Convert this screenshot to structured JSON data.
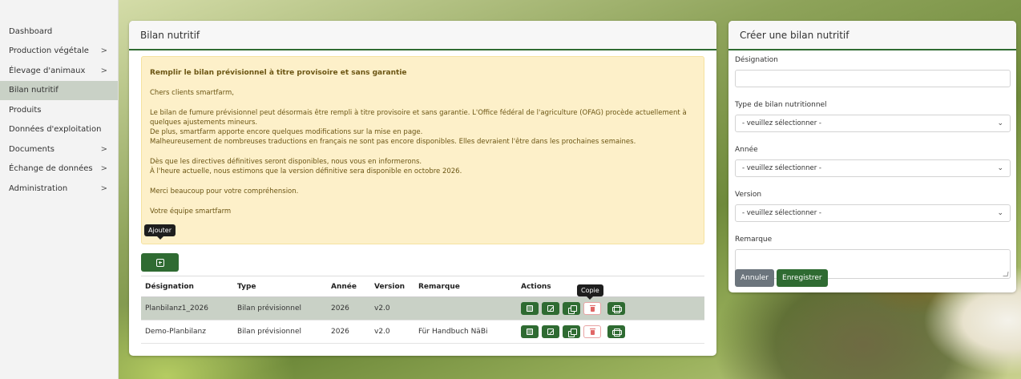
{
  "sidebar": {
    "items": [
      {
        "label": "Dashboard",
        "chevron": ""
      },
      {
        "label": "Production végétale",
        "chevron": ">"
      },
      {
        "label": "Élevage d'animaux",
        "chevron": ">"
      },
      {
        "label": "Bilan nutritif",
        "chevron": ""
      },
      {
        "label": "Produits",
        "chevron": ""
      },
      {
        "label": "Données d'exploitation",
        "chevron": ""
      },
      {
        "label": "Documents",
        "chevron": ">"
      },
      {
        "label": "Échange de données",
        "chevron": ">"
      },
      {
        "label": "Administration",
        "chevron": ">"
      }
    ],
    "active_index": 3
  },
  "main": {
    "title": "Bilan nutritif",
    "notice": {
      "title": "Remplir le bilan prévisionnel à titre provisoire et sans garantie",
      "greeting": "Chers clients smartfarm,",
      "line1": "Le bilan de fumure prévisionnel peut désormais être rempli à titre provisoire et sans garantie. L'Office fédéral de l'agriculture (OFAG) procède actuellement à quelques ajustements mineurs.",
      "line2": "De plus, smartfarm apporte encore quelques modifications sur la mise en page.",
      "line3": "Malheureusement de nombreuses traductions en français ne sont pas encore disponibles. Elles devraient l'être dans les prochaines semaines.",
      "line4": "Dès que les directives définitives seront disponibles, nous vous en informerons.",
      "line5": "À l'heure actuelle, nous estimons que la version définitive sera disponible en octobre 2026.",
      "thanks": "Merci beaucoup pour votre compréhension.",
      "signature": "Votre équipe smartfarm"
    },
    "tooltip_add": "Ajouter",
    "tooltip_copy": "Copie",
    "table": {
      "headers": [
        "Désignation",
        "Type",
        "Année",
        "Version",
        "Remarque",
        "Actions"
      ],
      "rows": [
        {
          "designation": "Planbilanz1_2026",
          "type": "Bilan prévisionnel",
          "annee": "2026",
          "version": "v2.0",
          "remarque": ""
        },
        {
          "designation": "Demo-Planbilanz",
          "type": "Bilan prévisionnel",
          "annee": "2026",
          "version": "v2.0",
          "remarque": "Für Handbuch NäBi"
        }
      ]
    }
  },
  "side": {
    "title": "Créer une bilan nutritif",
    "fields": {
      "designation_label": "Désignation",
      "designation_value": "",
      "type_label": "Type de bilan nutritionnel",
      "type_value": "- veuillez sélectionner -",
      "annee_label": "Année",
      "annee_value": "- veuillez sélectionner -",
      "version_label": "Version",
      "version_value": "- veuillez sélectionner -",
      "remarque_label": "Remarque",
      "remarque_value": ""
    },
    "cancel_label": "Annuler",
    "save_label": "Enregistrer"
  },
  "colors": {
    "primary": "#2f6b32",
    "notice_bg": "#fdf0c9",
    "active_nav": "#c9d1c6",
    "danger": "#e06666"
  }
}
